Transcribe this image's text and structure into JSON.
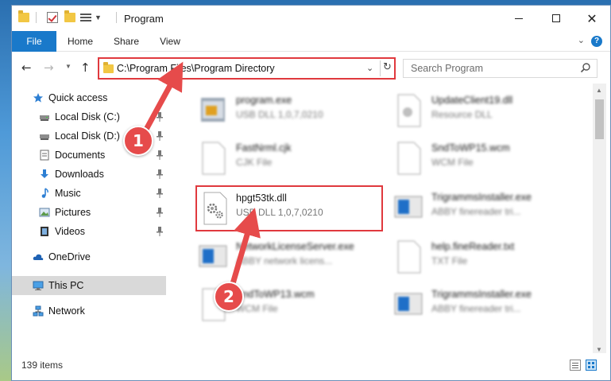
{
  "window": {
    "title": "Program"
  },
  "ribbon": {
    "tabs": [
      "File",
      "Home",
      "Share",
      "View"
    ]
  },
  "address_bar": {
    "path": "C:\\Program Files\\Program Directory"
  },
  "search": {
    "placeholder": "Search Program"
  },
  "nav_pane": {
    "items": [
      {
        "label": "Quick access",
        "icon": "star-icon"
      },
      {
        "label": "Local Disk (C:)",
        "icon": "drive-icon",
        "pinned": true
      },
      {
        "label": "Local Disk (D:)",
        "icon": "drive-icon",
        "pinned": true
      },
      {
        "label": "Documents",
        "icon": "documents-icon",
        "pinned": true
      },
      {
        "label": "Downloads",
        "icon": "downloads-icon",
        "pinned": true
      },
      {
        "label": "Music",
        "icon": "music-icon",
        "pinned": true
      },
      {
        "label": "Pictures",
        "icon": "pictures-icon",
        "pinned": true
      },
      {
        "label": "Videos",
        "icon": "videos-icon",
        "pinned": true
      },
      {
        "label": "OneDrive",
        "icon": "cloud-icon"
      },
      {
        "label": "This PC",
        "icon": "computer-icon",
        "selected": true
      },
      {
        "label": "Network",
        "icon": "network-icon"
      }
    ]
  },
  "files": [
    {
      "name": "program.exe",
      "type": "USB DLL 1,0,7,0210",
      "icon": "exe-icon"
    },
    {
      "name": "UpdateClient19.dll",
      "type": "Resource DLL",
      "icon": "dll-icon"
    },
    {
      "name": "FastNrml.cjk",
      "type": "CJK File",
      "icon": "blank-file-icon"
    },
    {
      "name": "SndToWP15.wcm",
      "type": "WCM File",
      "icon": "blank-file-icon"
    },
    {
      "name": "hpgt53tk.dll",
      "type": "USB DLL 1,0,7,0210",
      "icon": "dll-gear-icon",
      "highlighted": true
    },
    {
      "name": "TrigrammsInstaller.exe",
      "type": "ABBY finereader tri...",
      "icon": "installer-icon"
    },
    {
      "name": "NetworkLicenseServer.exe",
      "type": "ABBY network licens...",
      "icon": "installer-icon"
    },
    {
      "name": "help.fineReader.txt",
      "type": "TXT File",
      "icon": "blank-file-icon"
    },
    {
      "name": "SndToWP13.wcm",
      "type": "WCM File",
      "icon": "blank-file-icon"
    },
    {
      "name": "TrigrammsInstaller.exe",
      "type": "ABBY finereader tri...",
      "icon": "installer-icon"
    }
  ],
  "status": {
    "item_count": "139 items"
  },
  "annotations": {
    "step1": "1",
    "step2": "2",
    "color": "#e64b4b"
  },
  "colors": {
    "accent": "#1979ca",
    "highlight_border": "#e0393e"
  }
}
